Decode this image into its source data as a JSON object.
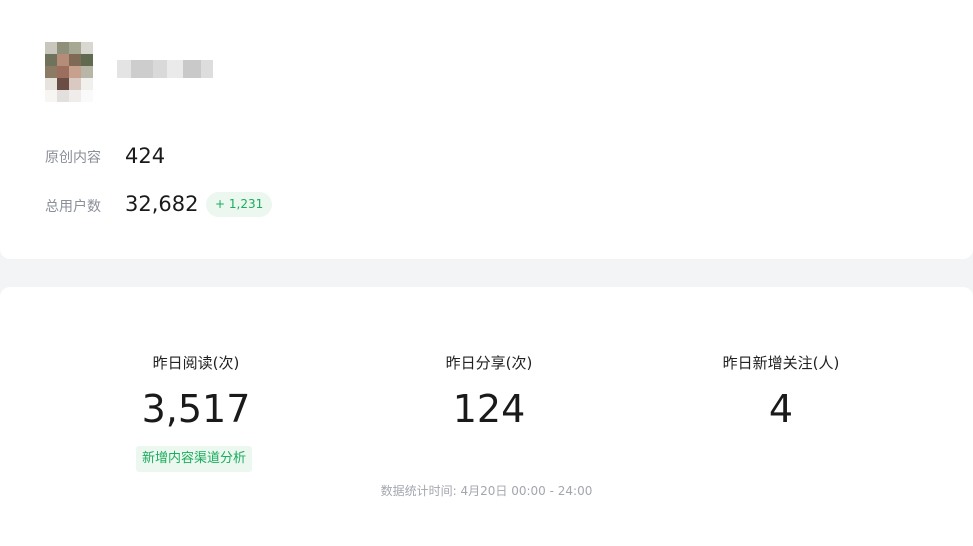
{
  "profile": {
    "avatar_icon": "avatar-icon",
    "name": ""
  },
  "account_stats": {
    "original_label": "原创内容",
    "original_value": "424",
    "users_label": "总用户数",
    "users_value": "32,682",
    "users_delta": "+ 1,231"
  },
  "metrics": [
    {
      "label": "昨日阅读(次)",
      "value": "3,517"
    },
    {
      "label": "昨日分享(次)",
      "value": "124"
    },
    {
      "label": "昨日新增关注(人)",
      "value": "4"
    }
  ],
  "channel_link_label": "新增内容渠道分析",
  "footnote": "数据统计时间: 4月20日 00:00 - 24:00",
  "colors": {
    "accent_green": "#1aad5d",
    "badge_bg": "#ecf7f0",
    "page_bg": "#f3f4f6"
  }
}
